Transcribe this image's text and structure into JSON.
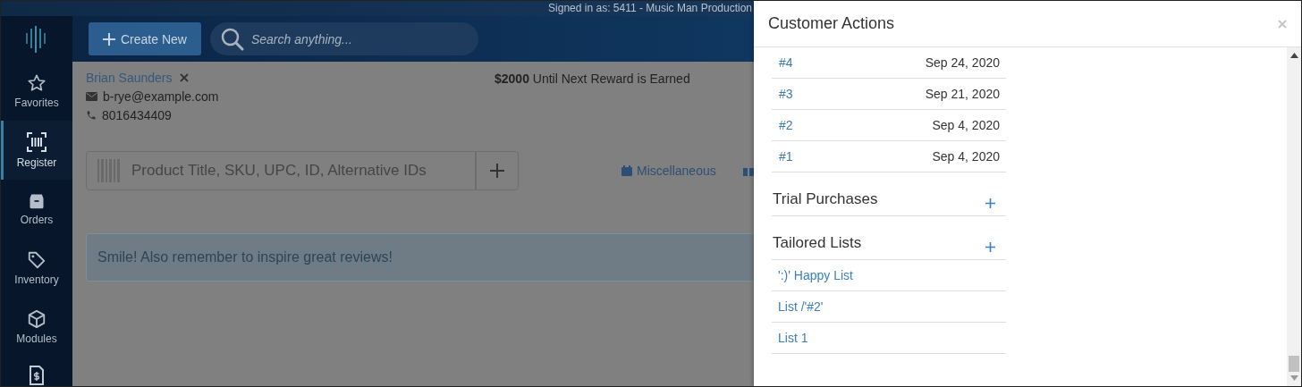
{
  "signed_in": "Signed in as: 5411 - Music Man Production",
  "topbar": {
    "create_button": "Create New",
    "search": {
      "placeholder": "Search anything..."
    }
  },
  "sidebar": {
    "items": [
      {
        "label": "Favorites",
        "selected": false
      },
      {
        "label": "Register",
        "selected": true
      },
      {
        "label": "Orders",
        "selected": false
      },
      {
        "label": "Inventory",
        "selected": false
      },
      {
        "label": "Modules",
        "selected": false
      }
    ]
  },
  "customer": {
    "name": "Brian Saunders",
    "email": "b-rye@example.com",
    "phone": "8016434409"
  },
  "reward": "**$2000** Until Next Reward is Earned",
  "product_search": {
    "placeholder": "Product Title, SKU, UPC, ID, Alternative IDs"
  },
  "quick_links": [
    "Miscellaneous"
  ],
  "alert": "Smile! Also remember to inspire great reviews!",
  "drawer": {
    "title": "Customer Actions",
    "orders": [
      {
        "number": "#4",
        "date": "Sep 24, 2020"
      },
      {
        "number": "#3",
        "date": "Sep 21, 2020"
      },
      {
        "number": "#2",
        "date": "Sep 4, 2020"
      },
      {
        "number": "#1",
        "date": "Sep 4, 2020"
      }
    ],
    "sections": [
      {
        "title": "Trial Purchases"
      },
      {
        "title": "Tailored Lists",
        "items": [
          "':)' Happy List",
          "List /'#2'",
          "List 1"
        ]
      }
    ]
  }
}
